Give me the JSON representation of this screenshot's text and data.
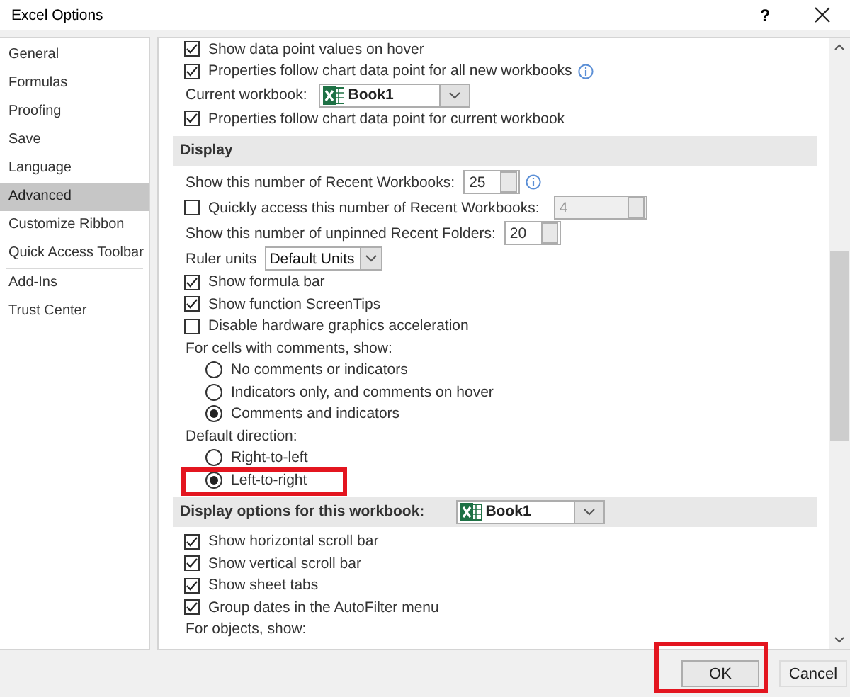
{
  "window": {
    "title": "Excel Options",
    "help_button": "?"
  },
  "sidebar": {
    "items": [
      {
        "label": "General",
        "selected": false
      },
      {
        "label": "Formulas",
        "selected": false
      },
      {
        "label": "Proofing",
        "selected": false
      },
      {
        "label": "Save",
        "selected": false
      },
      {
        "label": "Language",
        "selected": false
      },
      {
        "label": "Advanced",
        "selected": true
      },
      {
        "label": "Customize Ribbon",
        "selected": false
      },
      {
        "label": "Quick Access Toolbar",
        "selected": false,
        "separator_after": true
      },
      {
        "label": "Add-Ins",
        "selected": false
      },
      {
        "label": "Trust Center",
        "selected": false
      }
    ]
  },
  "rows": [
    {
      "kind": "checkbox",
      "label": "Show data point values on hover",
      "checked": true
    },
    {
      "kind": "checkbox",
      "label": "Properties follow chart data point for all new workbooks",
      "checked": true,
      "info_icon": true
    },
    {
      "kind": "combo",
      "label": "Current workbook:",
      "value": "Book1"
    },
    {
      "kind": "checkbox",
      "label": "Properties follow chart data point for current workbook",
      "checked": true
    },
    {
      "kind": "section",
      "label": "Display"
    },
    {
      "kind": "spinner",
      "label": "Show this number of Recent Workbooks:",
      "value": "25",
      "disabled": false,
      "info_icon": true
    },
    {
      "kind": "checkspinner",
      "label": "Quickly access this number of Recent Workbooks:",
      "checked": false,
      "value": "4",
      "disabled": true
    },
    {
      "kind": "spinner",
      "label": "Show this number of unpinned Recent Folders:",
      "value": "20",
      "disabled": false
    },
    {
      "kind": "dropdown",
      "label": "Ruler units",
      "value": "Default Units"
    },
    {
      "kind": "checkbox",
      "label": "Show formula bar",
      "checked": true
    },
    {
      "kind": "checkbox",
      "label": "Show function ScreenTips",
      "checked": true
    },
    {
      "kind": "checkbox",
      "label": "Disable hardware graphics acceleration",
      "checked": false
    },
    {
      "kind": "label",
      "label": "For cells with comments, show:"
    },
    {
      "kind": "radio",
      "label": "No comments or indicators",
      "selected": false
    },
    {
      "kind": "radio",
      "label": "Indicators only, and comments on hover",
      "selected": false
    },
    {
      "kind": "radio",
      "label": "Comments and indicators",
      "selected": true
    },
    {
      "kind": "label",
      "label": "Default direction:"
    },
    {
      "kind": "radio",
      "label": "Right-to-left",
      "selected": false
    },
    {
      "kind": "radio",
      "label": "Left-to-right",
      "selected": true,
      "highlighted": true
    },
    {
      "kind": "sectioncombo",
      "label": "Display options for this workbook:",
      "value": "Book1"
    },
    {
      "kind": "checkbox",
      "label": "Show horizontal scroll bar",
      "checked": true
    },
    {
      "kind": "checkbox",
      "label": "Show vertical scroll bar",
      "checked": true
    },
    {
      "kind": "checkbox",
      "label": "Show sheet tabs",
      "checked": true
    },
    {
      "kind": "checkbox",
      "label": "Group dates in the AutoFilter menu",
      "checked": true
    },
    {
      "kind": "label",
      "label": "For objects, show:"
    }
  ],
  "buttons": [
    {
      "label": "OK",
      "highlighted": true
    },
    {
      "label": "Cancel",
      "highlighted": false
    }
  ]
}
